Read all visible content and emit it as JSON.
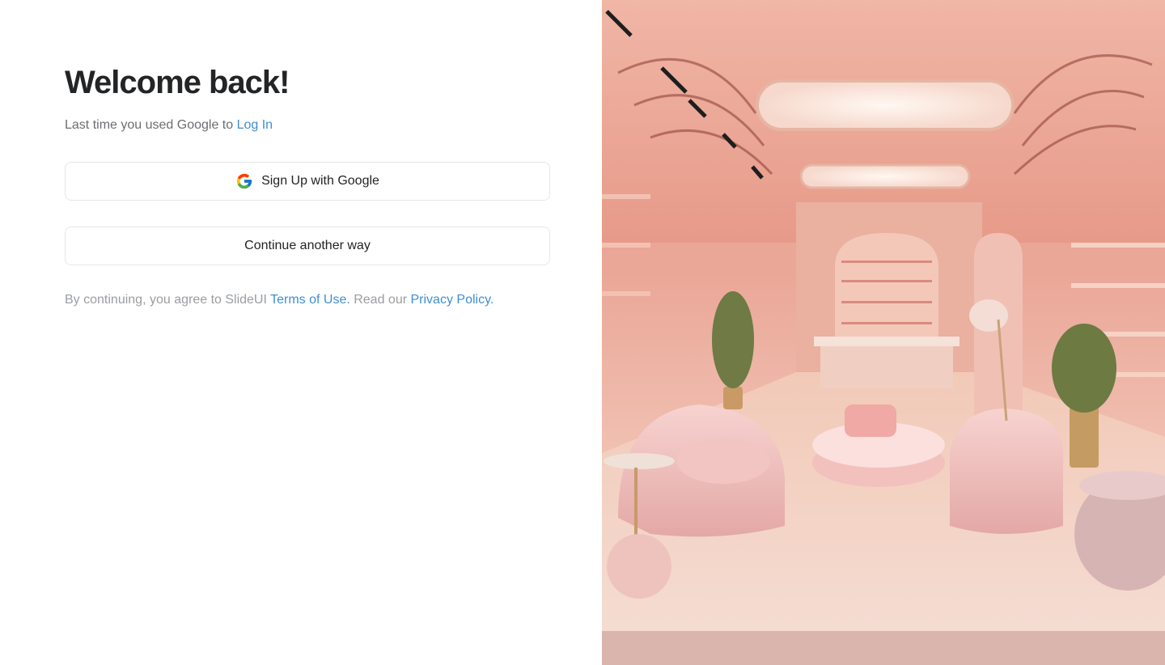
{
  "login": {
    "heading": "Welcome back!",
    "subtext_prefix": "Last time you used Google to ",
    "subtext_link": "Log In",
    "google_button_label": "Sign Up with Google",
    "other_button_label": "Continue another way",
    "legal_prefix": "By continuing, you agree to SlideUI ",
    "terms_link": "Terms of Use.",
    "legal_middle": " Read our ",
    "privacy_link": "Privacy Policy."
  },
  "icons": {
    "google": "google-g-logo"
  },
  "colors": {
    "link": "#3f8fd1",
    "heading": "#222426",
    "muted": "#6b6e72",
    "legal": "#9a9da1",
    "button_border": "#e6e7ea",
    "hero_pink": "#e9a08f"
  }
}
